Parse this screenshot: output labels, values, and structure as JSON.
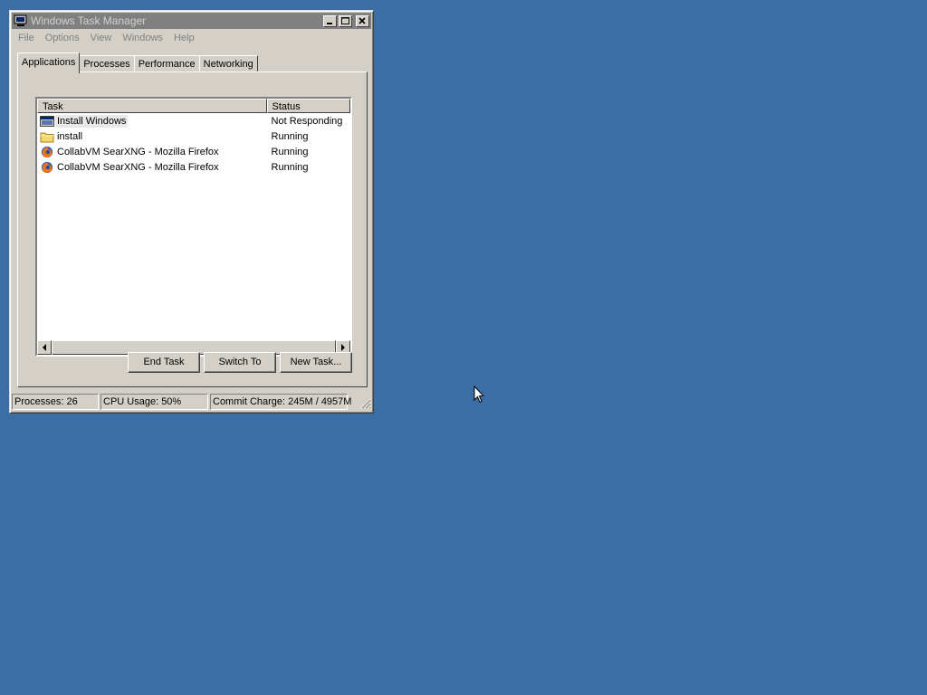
{
  "window": {
    "title": "Windows Task Manager",
    "controls": {
      "minimize": "_",
      "maximize": "□",
      "close": "✕"
    }
  },
  "menu": [
    "File",
    "Options",
    "View",
    "Windows",
    "Help"
  ],
  "tabs": [
    "Applications",
    "Processes",
    "Performance",
    "Networking"
  ],
  "active_tab": "Applications",
  "list": {
    "headers": {
      "task": "Task",
      "status": "Status"
    },
    "rows": [
      {
        "task": "Install Windows",
        "status": "Not Responding",
        "icon": "window-icon"
      },
      {
        "task": "install",
        "status": "Running",
        "icon": "folder-icon"
      },
      {
        "task": "CollabVM SearXNG - Mozilla Firefox",
        "status": "Running",
        "icon": "firefox-icon"
      },
      {
        "task": "CollabVM SearXNG - Mozilla Firefox",
        "status": "Running",
        "icon": "firefox-icon"
      }
    ]
  },
  "buttons": {
    "end_task": "End Task",
    "switch_to": "Switch To",
    "new_task": "New Task..."
  },
  "statusbar": {
    "processes": "Processes: 26",
    "cpu": "CPU Usage: 50%",
    "commit": "Commit Charge: 245M / 4957M"
  },
  "colors": {
    "desktop": "#3a6ea5",
    "titlebar_inactive": "#808080",
    "face": "#d4d0c8"
  }
}
